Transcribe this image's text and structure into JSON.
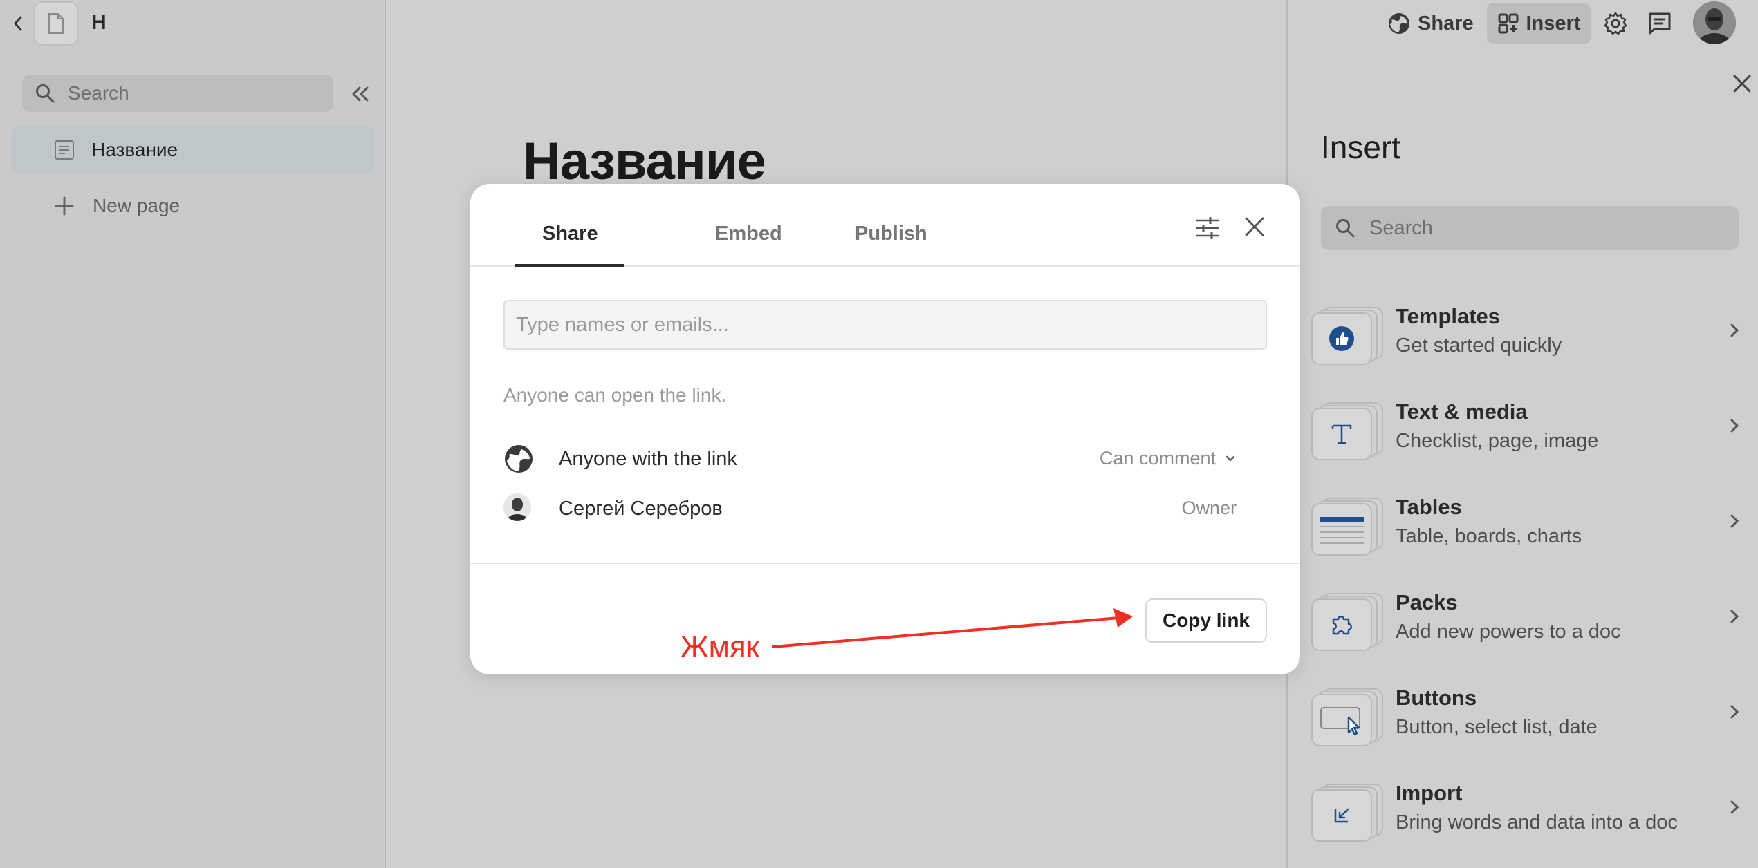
{
  "header": {
    "doc_initial": "Н",
    "share_label": "Share",
    "insert_label": "Insert"
  },
  "sidebar": {
    "search_label": "Search",
    "pages": [
      {
        "label": "Название"
      }
    ],
    "new_page_label": "New page"
  },
  "document": {
    "title": "Название"
  },
  "insert_panel": {
    "title": "Insert",
    "search_label": "Search",
    "items": [
      {
        "title": "Templates",
        "subtitle": "Get started quickly",
        "icon": "thumbs-up-icon"
      },
      {
        "title": "Text & media",
        "subtitle": "Checklist, page, image",
        "icon": "text-t-icon"
      },
      {
        "title": "Tables",
        "subtitle": "Table, boards, charts",
        "icon": "table-icon"
      },
      {
        "title": "Packs",
        "subtitle": "Add new powers to a doc",
        "icon": "puzzle-icon"
      },
      {
        "title": "Buttons",
        "subtitle": "Button, select list, date",
        "icon": "button-cursor-icon"
      },
      {
        "title": "Import",
        "subtitle": "Bring words and data into a doc",
        "icon": "import-icon"
      }
    ]
  },
  "share_dialog": {
    "tabs": [
      {
        "label": "Share",
        "active": true
      },
      {
        "label": "Embed",
        "active": false
      },
      {
        "label": "Publish",
        "active": false
      }
    ],
    "invite_placeholder": "Type names or emails...",
    "hint": "Anyone can open the link.",
    "permissions": [
      {
        "name": "Anyone with the link",
        "role": "Can comment",
        "icon": "globe-icon",
        "has_dropdown": true
      },
      {
        "name": "Сергей Серебров",
        "role": "Owner",
        "icon": "avatar",
        "has_dropdown": false
      }
    ],
    "copy_link_label": "Copy link"
  },
  "annotation": {
    "text": "Жмяк",
    "color": "#ee3124"
  },
  "colors": {
    "overlay_bg": "#cfcfcf",
    "dialog_bg": "#ffffff",
    "accent_icon": "#1f4e8c"
  }
}
